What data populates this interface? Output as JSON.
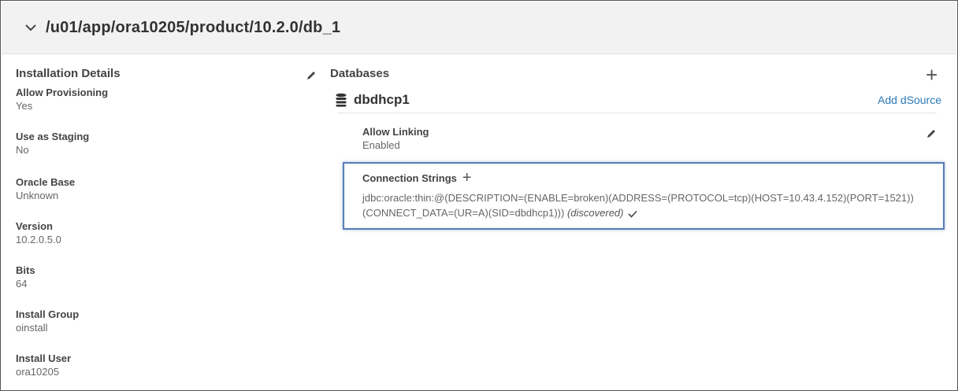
{
  "header": {
    "title": "/u01/app/ora10205/product/10.2.0/db_1",
    "chevron_icon": "chevron-down-icon"
  },
  "installation": {
    "title": "Installation Details",
    "edit_icon": "pencil-icon",
    "fields": [
      {
        "label": "Allow Provisioning",
        "value": "Yes"
      },
      {
        "label": "Use as Staging",
        "value": "No"
      },
      {
        "label": "Oracle Base",
        "value": "Unknown"
      },
      {
        "label": "Version",
        "value": "10.2.0.5.0"
      },
      {
        "label": "Bits",
        "value": "64"
      },
      {
        "label": "Install Group",
        "value": "oinstall"
      },
      {
        "label": "Install User",
        "value": "ora10205"
      }
    ]
  },
  "databases": {
    "title": "Databases",
    "add_icon": "plus-icon",
    "db": {
      "name": "dbdhcp1",
      "icon": "database-icon",
      "add_dsource_label": "Add dSource"
    },
    "allow_linking": {
      "label": "Allow Linking",
      "value": "Enabled",
      "edit_icon": "pencil-icon"
    },
    "connection_strings": {
      "label": "Connection Strings",
      "add_icon": "plus-icon",
      "value": "jdbc:oracle:thin:@(DESCRIPTION=(ENABLE=broken)(ADDRESS=(PROTOCOL=tcp)(HOST=10.43.4.152)(PORT=1521))(CONNECT_DATA=(UR=A)(SID=dbdhcp1)))",
      "status": "(discovered)",
      "status_icon": "checkmark-icon"
    }
  },
  "colors": {
    "link": "#2a7ab8",
    "highlight_border": "#5a7fb5",
    "header_bg": "#f2f2f2"
  }
}
